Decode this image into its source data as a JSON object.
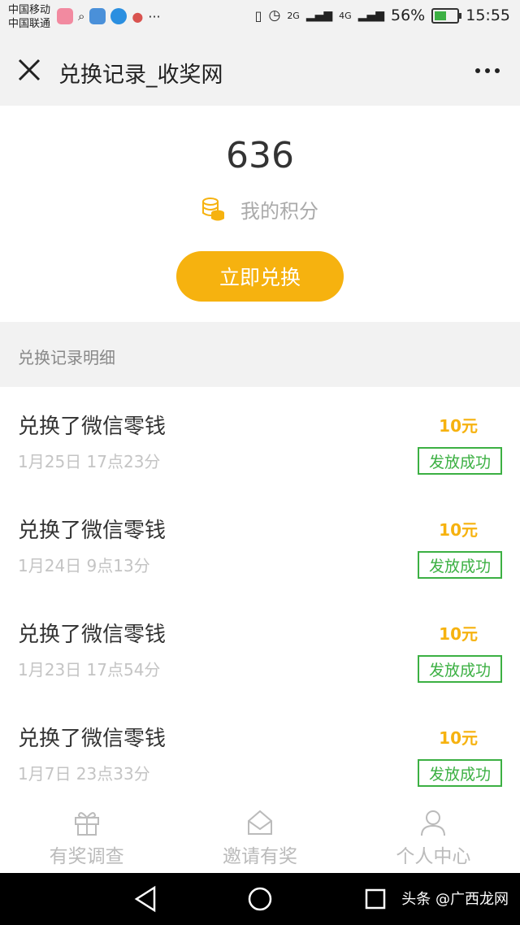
{
  "status_bar": {
    "carrier_1": "中国移动",
    "carrier_2": "中国联通",
    "network_1": "2G",
    "network_2": "4G",
    "battery": "56%",
    "time": "15:55"
  },
  "title_bar": {
    "title": "兑换记录_收奖网",
    "close_icon": "close-icon",
    "more_icon": "more-icon"
  },
  "points": {
    "value": "636",
    "label": "我的积分",
    "redeem_label": "立即兑换"
  },
  "records_section": {
    "title": "兑换记录明细"
  },
  "records": [
    {
      "title": "兑换了微信零钱",
      "time": "1月25日 17点23分",
      "amount": "10元",
      "status": "发放成功"
    },
    {
      "title": "兑换了微信零钱",
      "time": "1月24日 9点13分",
      "amount": "10元",
      "status": "发放成功"
    },
    {
      "title": "兑换了微信零钱",
      "time": "1月23日 17点54分",
      "amount": "10元",
      "status": "发放成功"
    },
    {
      "title": "兑换了微信零钱",
      "time": "1月7日 23点33分",
      "amount": "10元",
      "status": "发放成功"
    }
  ],
  "tabs": [
    {
      "label": "有奖调查",
      "icon": "gift-icon"
    },
    {
      "label": "邀请有奖",
      "icon": "envelope-icon"
    },
    {
      "label": "个人中心",
      "icon": "person-icon"
    }
  ],
  "watermark": "头条 @广西龙网",
  "colors": {
    "accent": "#f6b20f",
    "success": "#3cb043",
    "header_bg": "#f2f2f2"
  }
}
